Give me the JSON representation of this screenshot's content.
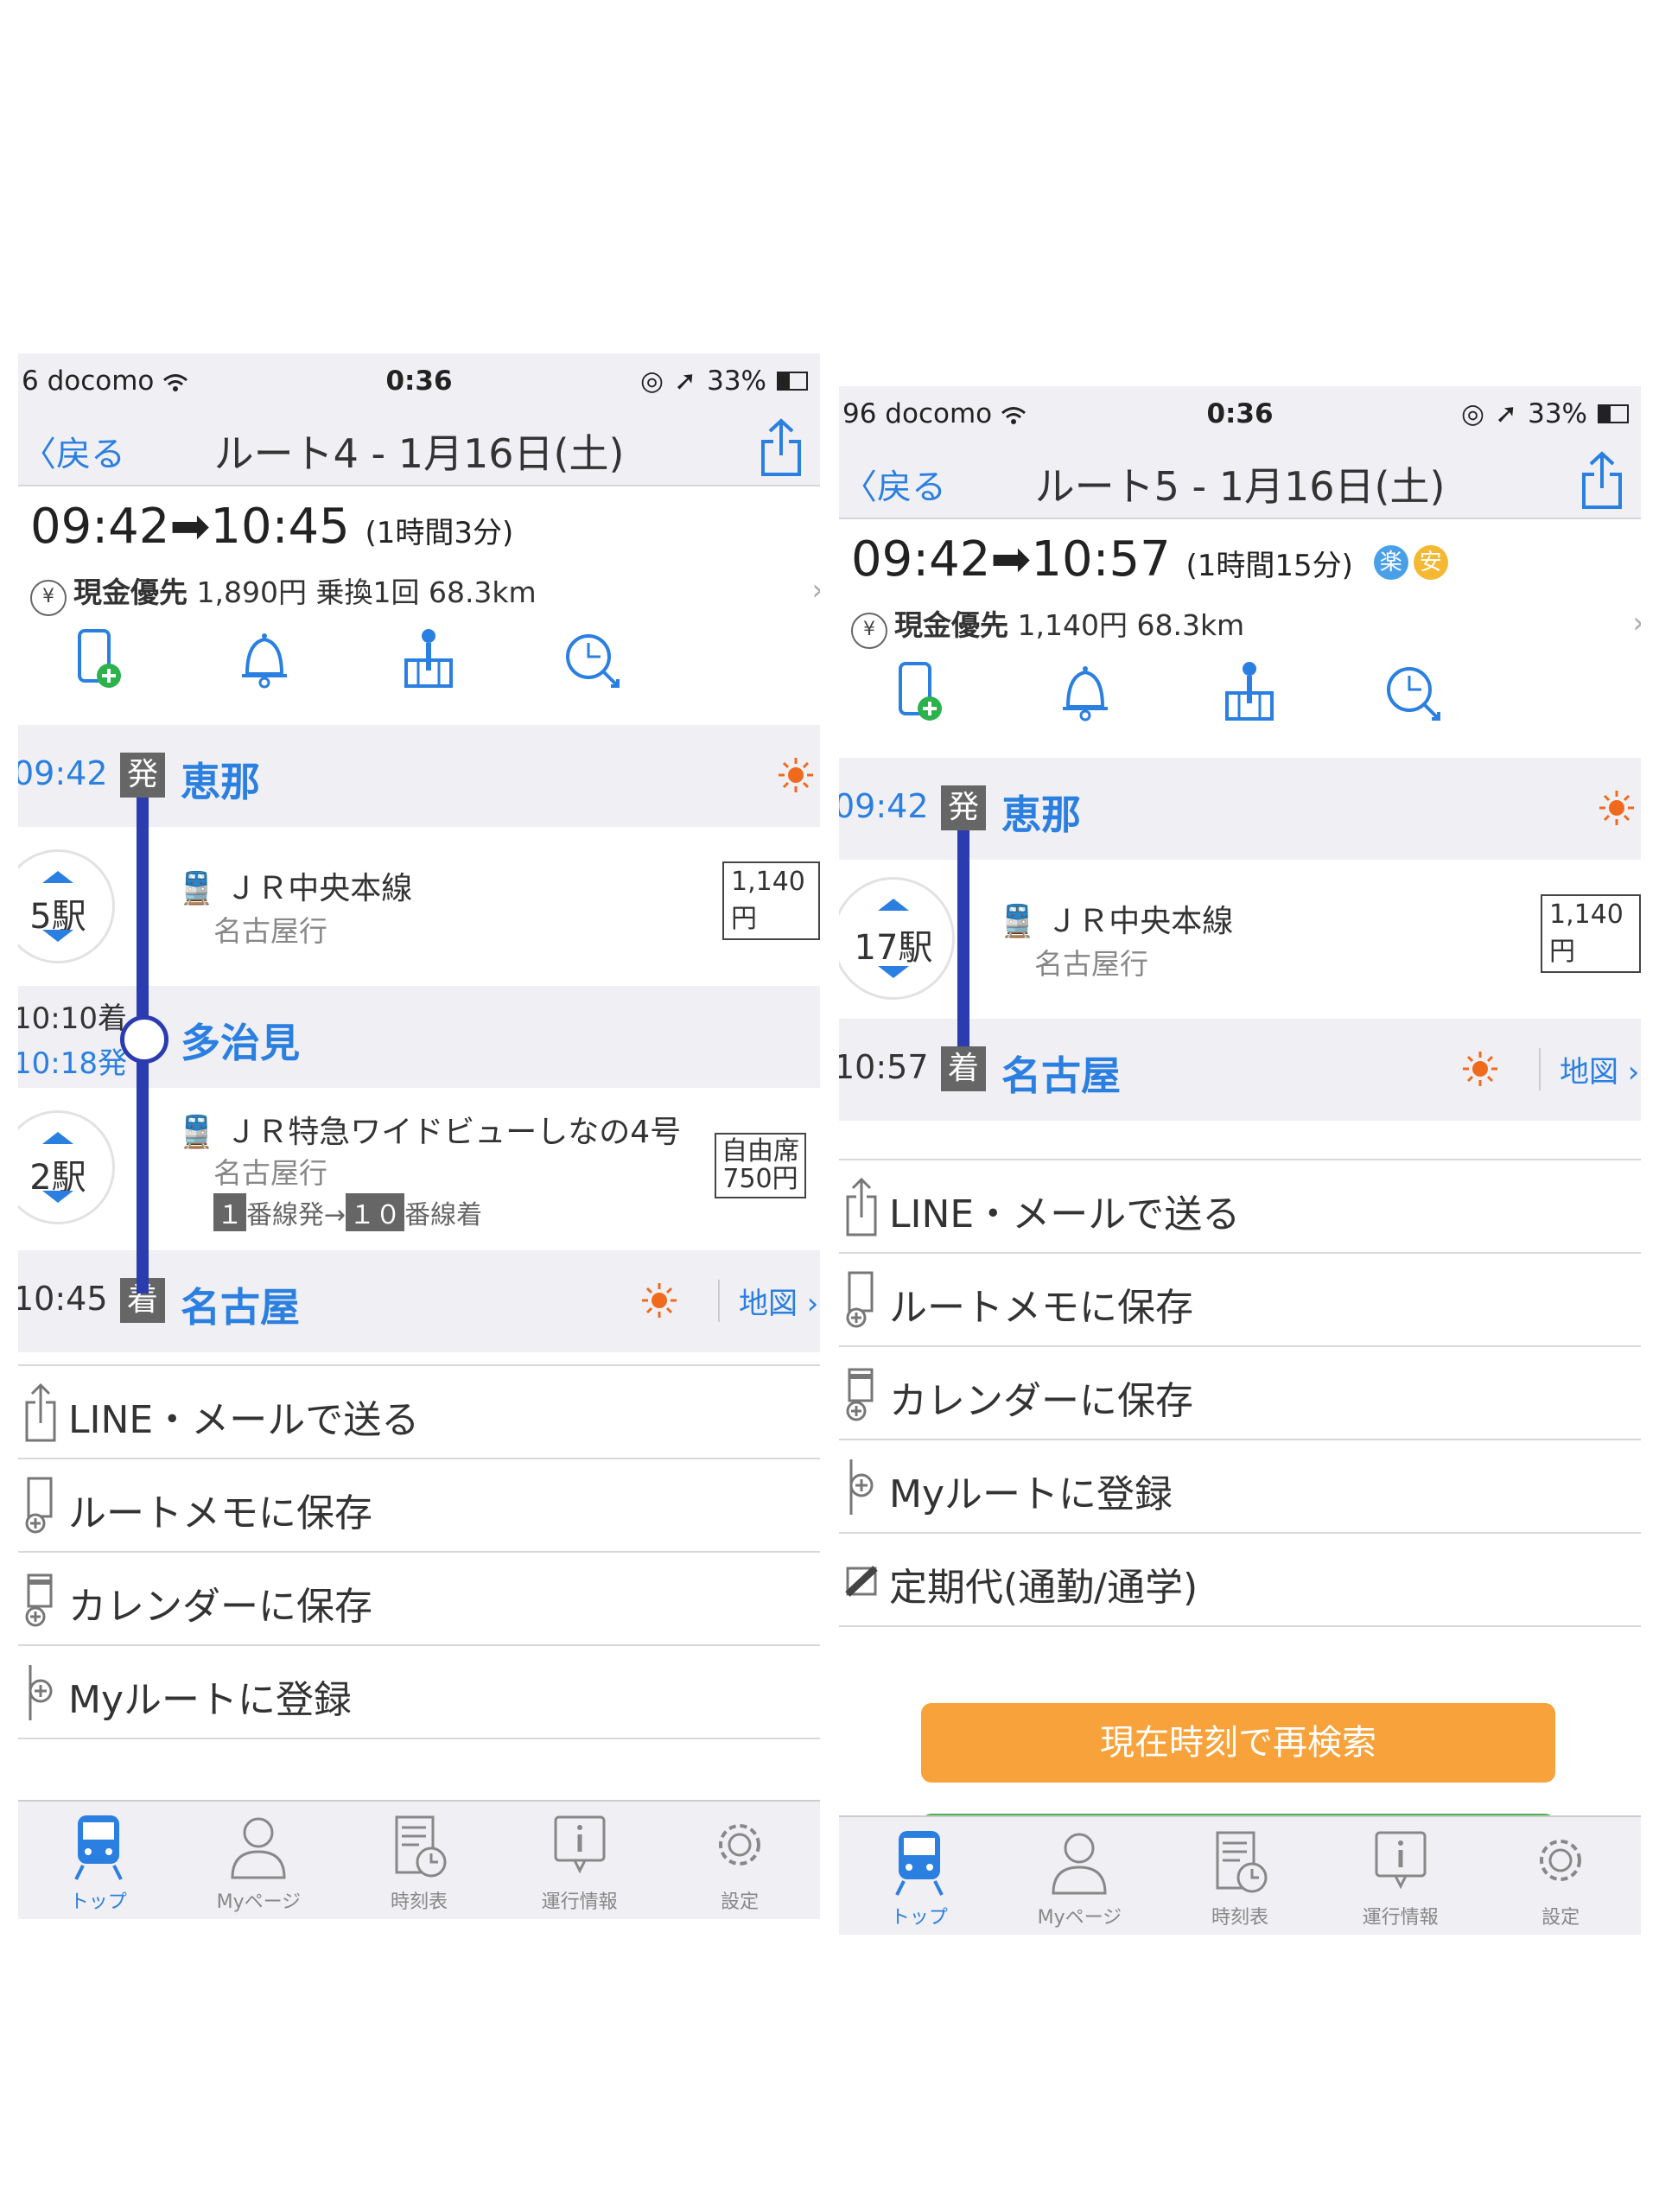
{
  "colors": {
    "accent": "#2a7fe0",
    "route_line": "#2b3bb0",
    "sun": "#f06a1e",
    "button": "#f7a23a",
    "badge_raku": "#4aa0e8",
    "badge_an": "#f4b833"
  },
  "left": {
    "status": {
      "carrier": "6 docomo",
      "time": "0:36",
      "battery": "33%"
    },
    "nav": {
      "back": "戻る",
      "title": "ルート4 - 1月16日(土)"
    },
    "summary": {
      "depart": "09:42",
      "arrive": "10:45",
      "duration": "(1時間3分)",
      "fare_type": "現金優先",
      "fare_rest": "1,890円 乗換1回 68.3km"
    },
    "route": {
      "s1": {
        "time": "09:42",
        "mark": "発",
        "name": "恵那"
      },
      "seg1": {
        "count": "5駅",
        "line": "ＪＲ中央本線",
        "dest": "名古屋行",
        "fare": "1,140円"
      },
      "s2": {
        "arr": "10:10着",
        "dep": "10:18発",
        "name": "多治見"
      },
      "seg2": {
        "count": "2駅",
        "line": "ＪＲ特急ワイドビューしなの4号",
        "dest": "名古屋行",
        "plat1": "１",
        "plat1_text": "番線発→",
        "plat2": "１０",
        "plat2_text": "番線着",
        "fare_l1": "自由席",
        "fare_l2": "750円"
      },
      "s3": {
        "time": "10:45",
        "mark": "着",
        "name": "名古屋",
        "map": "地図"
      }
    },
    "menu": [
      "LINE・メールで送る",
      "ルートメモに保存",
      "カレンダーに保存",
      "Myルートに登録"
    ]
  },
  "right": {
    "status": {
      "carrier": "96 docomo",
      "time": "0:36",
      "battery": "33%"
    },
    "nav": {
      "back": "戻る",
      "title": "ルート5 - 1月16日(土)"
    },
    "summary": {
      "depart": "09:42",
      "arrive": "10:57",
      "duration": "(1時間15分)",
      "badge1": "楽",
      "badge2": "安",
      "fare_type": "現金優先",
      "fare_rest": "1,140円 68.3km"
    },
    "route": {
      "s1": {
        "time": "09:42",
        "mark": "発",
        "name": "恵那"
      },
      "seg1": {
        "count": "17駅",
        "line": "ＪＲ中央本線",
        "dest": "名古屋行",
        "fare": "1,140円"
      },
      "s2": {
        "time": "10:57",
        "mark": "着",
        "name": "名古屋",
        "map": "地図"
      }
    },
    "menu": [
      "LINE・メールで送る",
      "ルートメモに保存",
      "カレンダーに保存",
      "Myルートに登録",
      "定期代(通勤/通学)"
    ],
    "button": "現在時刻で再検索"
  },
  "tabs": [
    "トップ",
    "Myページ",
    "時刻表",
    "運行情報",
    "設定"
  ],
  "yen_symbol": "¥"
}
